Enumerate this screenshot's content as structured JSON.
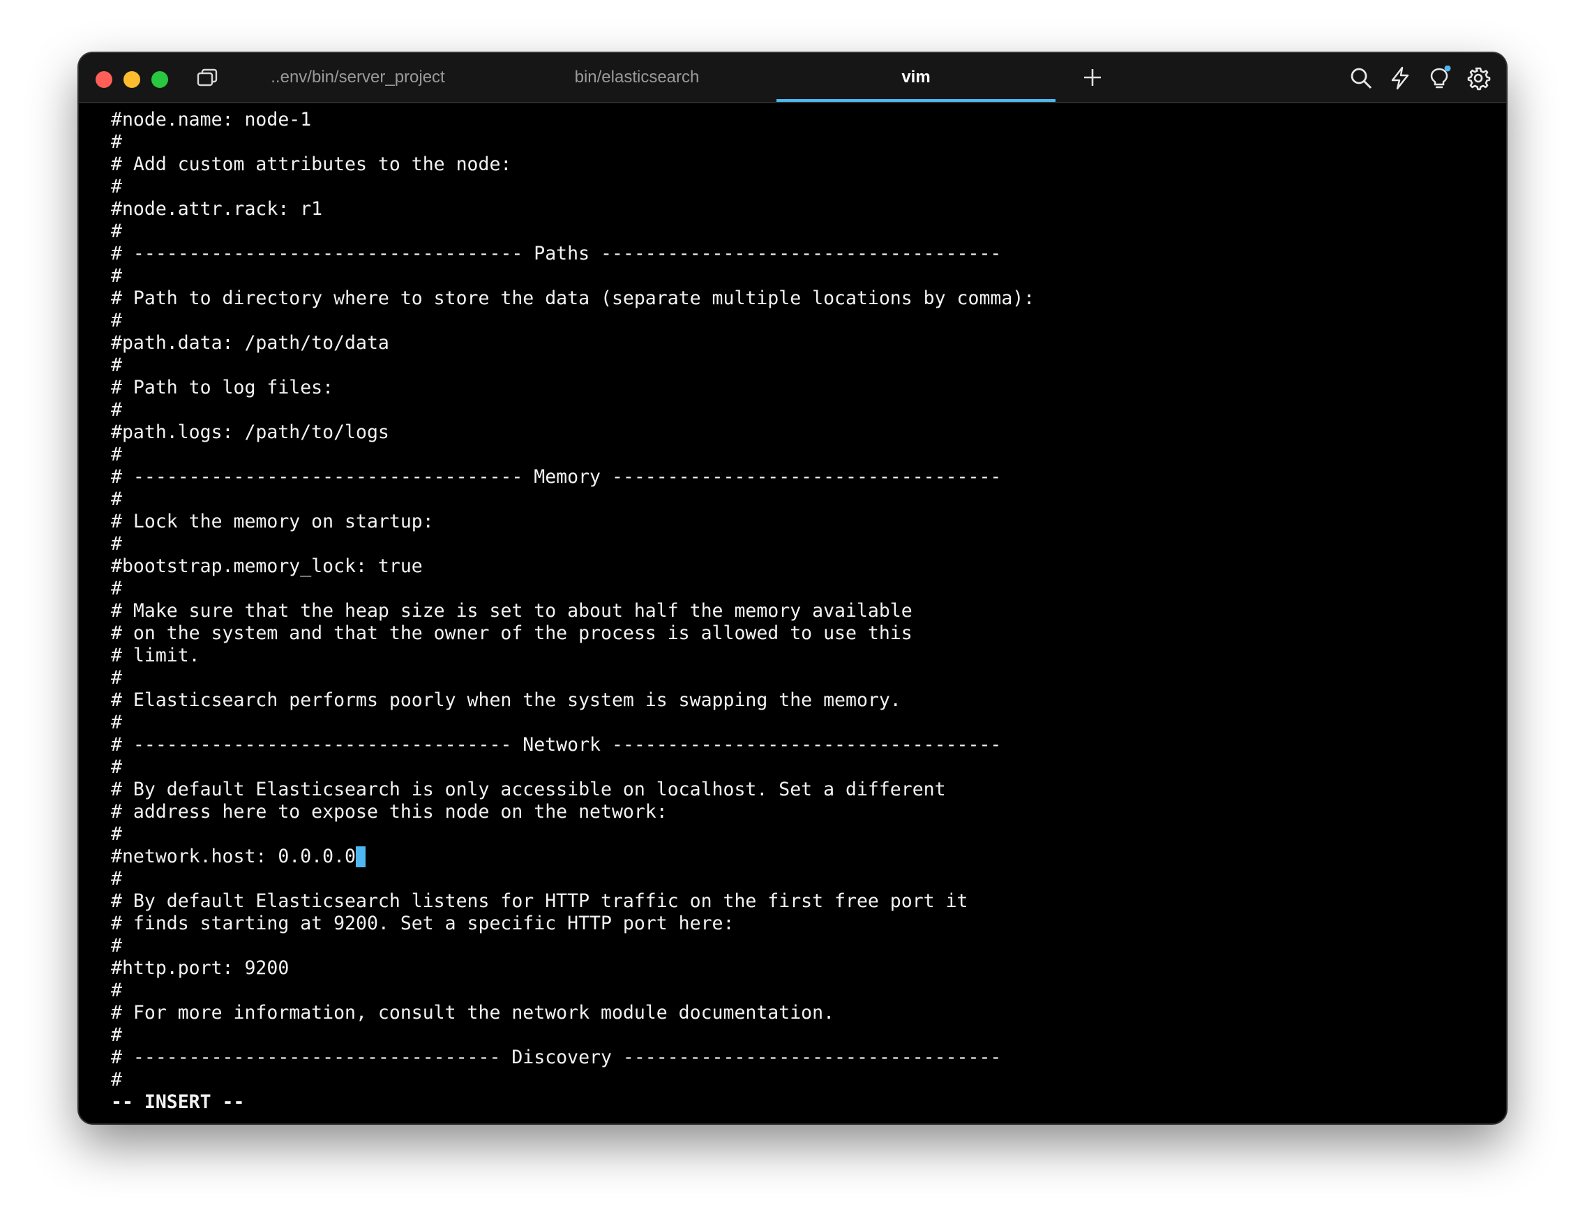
{
  "tabs": [
    {
      "label": "..env/bin/server_project",
      "active": false
    },
    {
      "label": "bin/elasticsearch",
      "active": false
    },
    {
      "label": "vim",
      "active": true
    }
  ],
  "toolbar": {
    "icons": [
      "search-icon",
      "bolt-icon",
      "lightbulb-icon",
      "gear-icon"
    ],
    "notification_dot_color": "#4fb7f0"
  },
  "colors": {
    "accent": "#4fb7f0",
    "background": "#000000",
    "text": "#f2f2f2"
  },
  "editor": {
    "lines": [
      "#node.name: node-1",
      "#",
      "# Add custom attributes to the node:",
      "#",
      "#node.attr.rack: r1",
      "#",
      "# ----------------------------------- Paths ------------------------------------",
      "#",
      "# Path to directory where to store the data (separate multiple locations by comma):",
      "#",
      "#path.data: /path/to/data",
      "#",
      "# Path to log files:",
      "#",
      "#path.logs: /path/to/logs",
      "#",
      "# ----------------------------------- Memory -----------------------------------",
      "#",
      "# Lock the memory on startup:",
      "#",
      "#bootstrap.memory_lock: true",
      "#",
      "# Make sure that the heap size is set to about half the memory available",
      "# on the system and that the owner of the process is allowed to use this",
      "# limit.",
      "#",
      "# Elasticsearch performs poorly when the system is swapping the memory.",
      "#",
      "# ---------------------------------- Network -----------------------------------",
      "#",
      "# By default Elasticsearch is only accessible on localhost. Set a different",
      "# address here to expose this node on the network:",
      "#",
      "#network.host: 0.0.0.0",
      "#",
      "# By default Elasticsearch listens for HTTP traffic on the first free port it",
      "# finds starting at 9200. Set a specific HTTP port here:",
      "#",
      "#http.port: 9200",
      "#",
      "# For more information, consult the network module documentation.",
      "#",
      "# --------------------------------- Discovery ----------------------------------",
      "#"
    ],
    "cursor_line": 33,
    "mode": "-- INSERT --"
  }
}
